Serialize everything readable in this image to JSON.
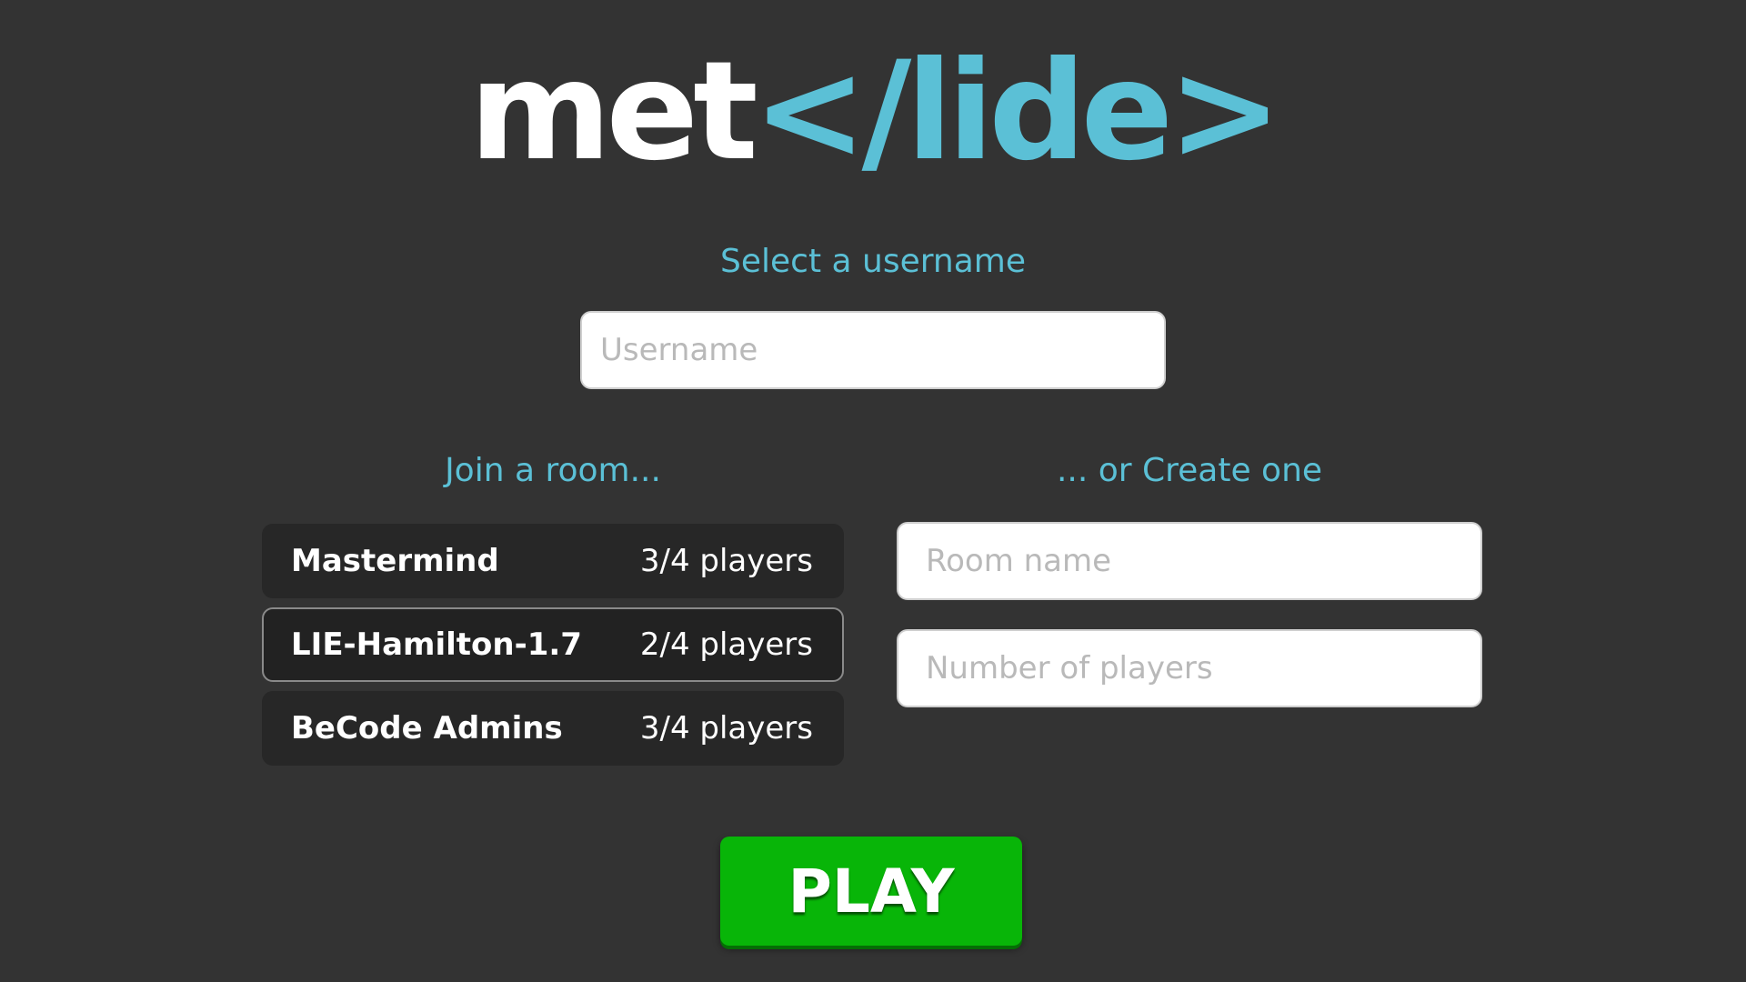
{
  "logo": {
    "part_white": "met",
    "part_teal": "</lide>"
  },
  "username_section": {
    "label": "Select a username",
    "placeholder": "Username",
    "value": ""
  },
  "join_section": {
    "label": "Join a room...",
    "rooms": [
      {
        "name": "Mastermind",
        "players": "3/4 players"
      },
      {
        "name": "LIE-Hamilton-1.7",
        "players": "2/4 players"
      },
      {
        "name": "BeCode Admins",
        "players": "3/4 players"
      }
    ]
  },
  "create_section": {
    "label": "... or Create one",
    "room_name_placeholder": "Room name",
    "players_placeholder": "Number of players"
  },
  "play_button": {
    "label": "PLAY"
  },
  "colors": {
    "background": "#333333",
    "accent": "#5bc0d6",
    "play_green": "#08b508",
    "room_bg": "#272727"
  }
}
